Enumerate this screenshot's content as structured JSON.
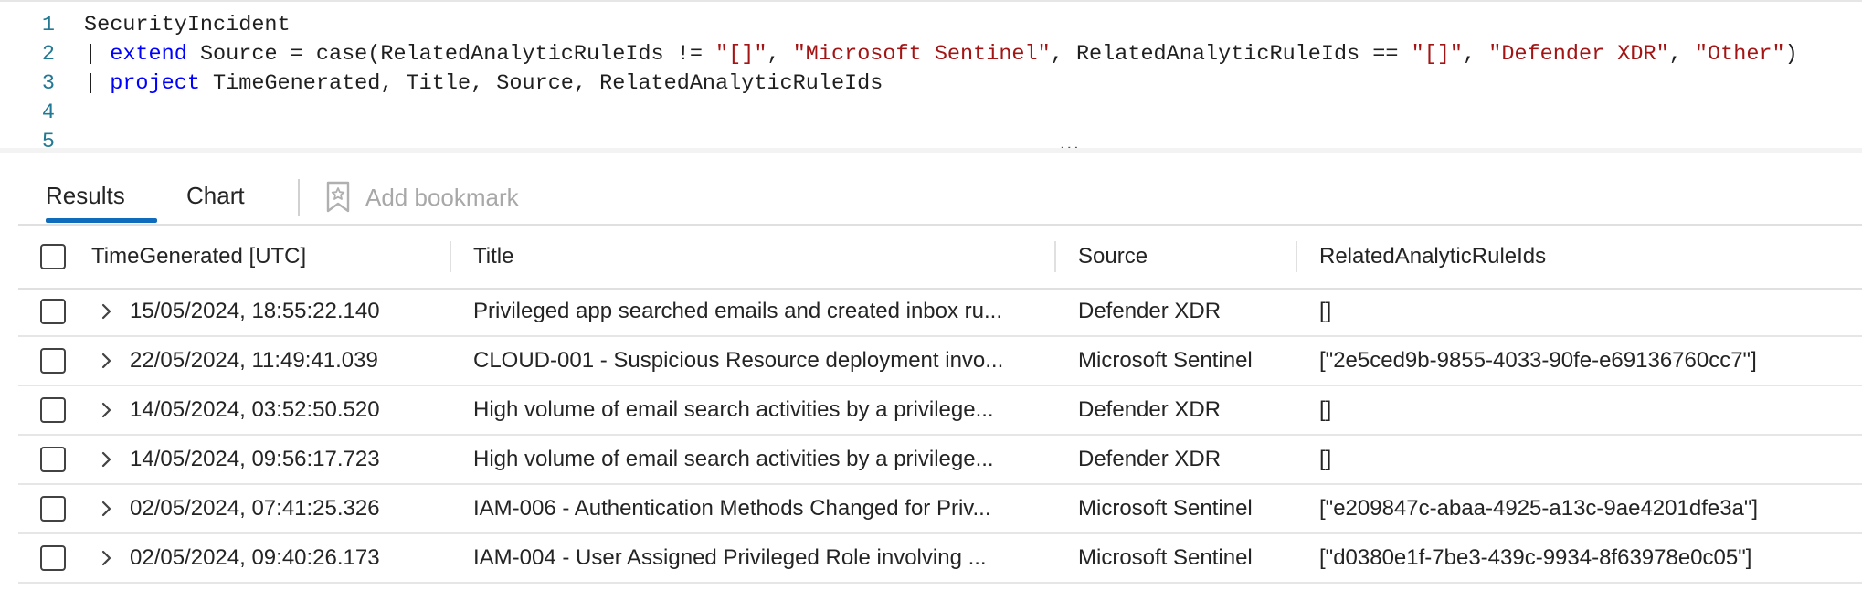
{
  "editor": {
    "lines": [
      {
        "n": "1",
        "tokens": [
          {
            "t": "SecurityIncident",
            "c": "plain"
          }
        ]
      },
      {
        "n": "2",
        "tokens": [
          {
            "t": "| ",
            "c": "pipe"
          },
          {
            "t": "extend",
            "c": "kw"
          },
          {
            "t": " Source = case(RelatedAnalyticRuleIds != ",
            "c": "plain"
          },
          {
            "t": "\"[]\"",
            "c": "str"
          },
          {
            "t": ", ",
            "c": "plain"
          },
          {
            "t": "\"Microsoft Sentinel\"",
            "c": "str"
          },
          {
            "t": ", RelatedAnalyticRuleIds == ",
            "c": "plain"
          },
          {
            "t": "\"[]\"",
            "c": "str"
          },
          {
            "t": ", ",
            "c": "plain"
          },
          {
            "t": "\"Defender XDR\"",
            "c": "str"
          },
          {
            "t": ", ",
            "c": "plain"
          },
          {
            "t": "\"Other\"",
            "c": "str"
          },
          {
            "t": ")",
            "c": "plain"
          }
        ]
      },
      {
        "n": "3",
        "tokens": [
          {
            "t": "| ",
            "c": "pipe"
          },
          {
            "t": "project",
            "c": "kw"
          },
          {
            "t": " TimeGenerated, Title, Source, RelatedAnalyticRuleIds",
            "c": "plain"
          }
        ]
      },
      {
        "n": "4",
        "tokens": []
      },
      {
        "n": "5",
        "tokens": []
      }
    ],
    "splitter_grip": "..."
  },
  "tabs": {
    "results_label": "Results",
    "chart_label": "Chart",
    "add_bookmark_label": "Add bookmark",
    "active": "Results"
  },
  "grid": {
    "columns": [
      "TimeGenerated [UTC]",
      "Title",
      "Source",
      "RelatedAnalyticRuleIds"
    ],
    "rows": [
      {
        "time": "15/05/2024, 18:55:22.140",
        "title": "Privileged app searched emails and created inbox ru...",
        "source": "Defender XDR",
        "rules": "[]"
      },
      {
        "time": "22/05/2024, 11:49:41.039",
        "title": "CLOUD-001 - Suspicious Resource deployment invo...",
        "source": "Microsoft Sentinel",
        "rules": "[\"2e5ced9b-9855-4033-90fe-e69136760cc7\"]"
      },
      {
        "time": "14/05/2024, 03:52:50.520",
        "title": "High volume of email search activities by a privilege...",
        "source": "Defender XDR",
        "rules": "[]"
      },
      {
        "time": "14/05/2024, 09:56:17.723",
        "title": "High volume of email search activities by a privilege...",
        "source": "Defender XDR",
        "rules": "[]"
      },
      {
        "time": "02/05/2024, 07:41:25.326",
        "title": "IAM-006 - Authentication Methods Changed for Priv...",
        "source": "Microsoft Sentinel",
        "rules": "[\"e209847c-abaa-4925-a13c-9ae4201dfe3a\"]"
      },
      {
        "time": "02/05/2024, 09:40:26.173",
        "title": "IAM-004 - User Assigned Privileged Role involving ...",
        "source": "Microsoft Sentinel",
        "rules": "[\"d0380e1f-7be3-439c-9934-8f63978e0c05\"]"
      }
    ]
  },
  "colors": {
    "accent": "#0f6cbd",
    "keyword": "#0000ff",
    "string": "#a31515",
    "line_number": "#237893"
  },
  "icons": [
    "bookmark-icon",
    "checkbox-icon",
    "chevron-right-icon"
  ]
}
